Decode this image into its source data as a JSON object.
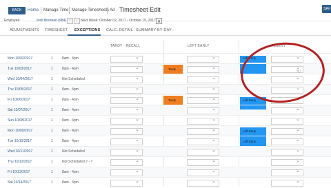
{
  "header": {
    "back_label": "BACK",
    "breadcrumbs": [
      "Home",
      "Manage Time",
      "Manage Timesheets",
      "Ad"
    ],
    "title": "Timesheet Edit",
    "right_button": "SAV"
  },
  "employee": {
    "label": "Employee:",
    "name": "Josh Brennan (984)",
    "period": "Next Week: October 02, 2017 - October 15, 2017"
  },
  "tabs": [
    {
      "label": "ADJUSTMENTS"
    },
    {
      "label": "TIMESHEET"
    },
    {
      "label": "EXCEPTIONS",
      "active": true
    },
    {
      "label": "CALC. DETAIL"
    },
    {
      "label": "SUMMARY BY DAY"
    }
  ],
  "columns": {
    "tardy": "TARDY · RECALL",
    "left_early": "LEFT EARLY",
    "absent": "ABSENT"
  },
  "rows": [
    {
      "date": "Mon 10/02/2017",
      "num": "1",
      "sched": "8am - 4pm",
      "absent_chip": "Left Early"
    },
    {
      "date": "Tue 10/03/2017",
      "num": "1",
      "sched": "8am - 4pm",
      "tardy_chip": "Tardy"
    },
    {
      "date": "Wed 10/04/2017",
      "num": "1",
      "sched": "Not Scheduled"
    },
    {
      "date": "Thu 10/05/2017",
      "num": "1",
      "sched": "8am - 4pm"
    },
    {
      "date": "Fri 10/06/2017",
      "num": "1",
      "sched": "8am - 4pm",
      "tardy_chip": "Tardy",
      "absent_chip": "Left Early"
    },
    {
      "date": "Sat 10/07/2017",
      "num": "1",
      "sched": "8am - 4pm"
    },
    {
      "date": "Sun 10/08/2017",
      "num": "1",
      "sched": "8am - 4pm"
    },
    {
      "date": "Mon 10/09/2017",
      "num": "1",
      "sched": "8am - 4pm",
      "absent_chip": "Left Early"
    },
    {
      "date": "Tue 10/10/2017",
      "num": "1",
      "sched": "8am - 4pm",
      "absent_chip": "Left Early"
    },
    {
      "date": "Wed 10/11/2017",
      "num": "1",
      "sched": "Not Scheduled"
    },
    {
      "date": "Thu 10/12/2017",
      "num": "1",
      "sched": "Not Scheduled 7 - ?"
    },
    {
      "date": "Fri 10/13/2017",
      "num": "1",
      "sched": "8am - 4pm"
    },
    {
      "date": "Sat 10/14/2017",
      "num": "1",
      "sched": "8am - 4pm"
    }
  ],
  "colors": {
    "accent": "#2f5d8a",
    "tardy": "#f07e1e",
    "left_early": "#2196f3",
    "annotation": "#b32020"
  },
  "icons": [
    "calendar-icon",
    "chevron-left-icon",
    "chevron-right-icon",
    "chevron-down-icon",
    "pointer-cursor-icon"
  ]
}
